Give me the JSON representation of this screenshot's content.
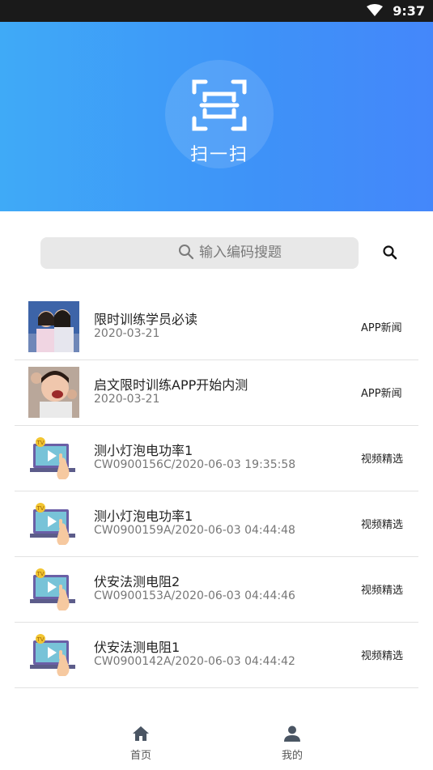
{
  "status": {
    "time": "9:37"
  },
  "hero": {
    "scan_label": "扫一扫"
  },
  "search": {
    "placeholder": "输入编码搜题"
  },
  "items": [
    {
      "title": "限时训练学员必读",
      "subtitle": "2020-03-21",
      "tag": "APP新闻",
      "thumb": "photo-girls"
    },
    {
      "title": "启文限时训练APP开始内测",
      "subtitle": "2020-03-21",
      "tag": "APP新闻",
      "thumb": "photo-shout"
    },
    {
      "title": "测小灯泡电功率1",
      "subtitle": "CW0900156C/2020-06-03 19:35:58",
      "tag": "视频精选",
      "thumb": "video-lesson-icon"
    },
    {
      "title": "测小灯泡电功率1",
      "subtitle": "CW0900159A/2020-06-03 04:44:48",
      "tag": "视频精选",
      "thumb": "video-lesson-icon"
    },
    {
      "title": "伏安法测电阻2",
      "subtitle": "CW0900153A/2020-06-03 04:44:46",
      "tag": "视频精选",
      "thumb": "video-lesson-icon"
    },
    {
      "title": "伏安法测电阻1",
      "subtitle": "CW0900142A/2020-06-03 04:44:42",
      "tag": "视频精选",
      "thumb": "video-lesson-icon"
    }
  ],
  "tabs": [
    {
      "label": "首页",
      "icon": "home-icon"
    },
    {
      "label": "我的",
      "icon": "person-icon"
    }
  ],
  "colors": {
    "hero_start": "#3faaf7",
    "hero_end": "#4487fa"
  }
}
